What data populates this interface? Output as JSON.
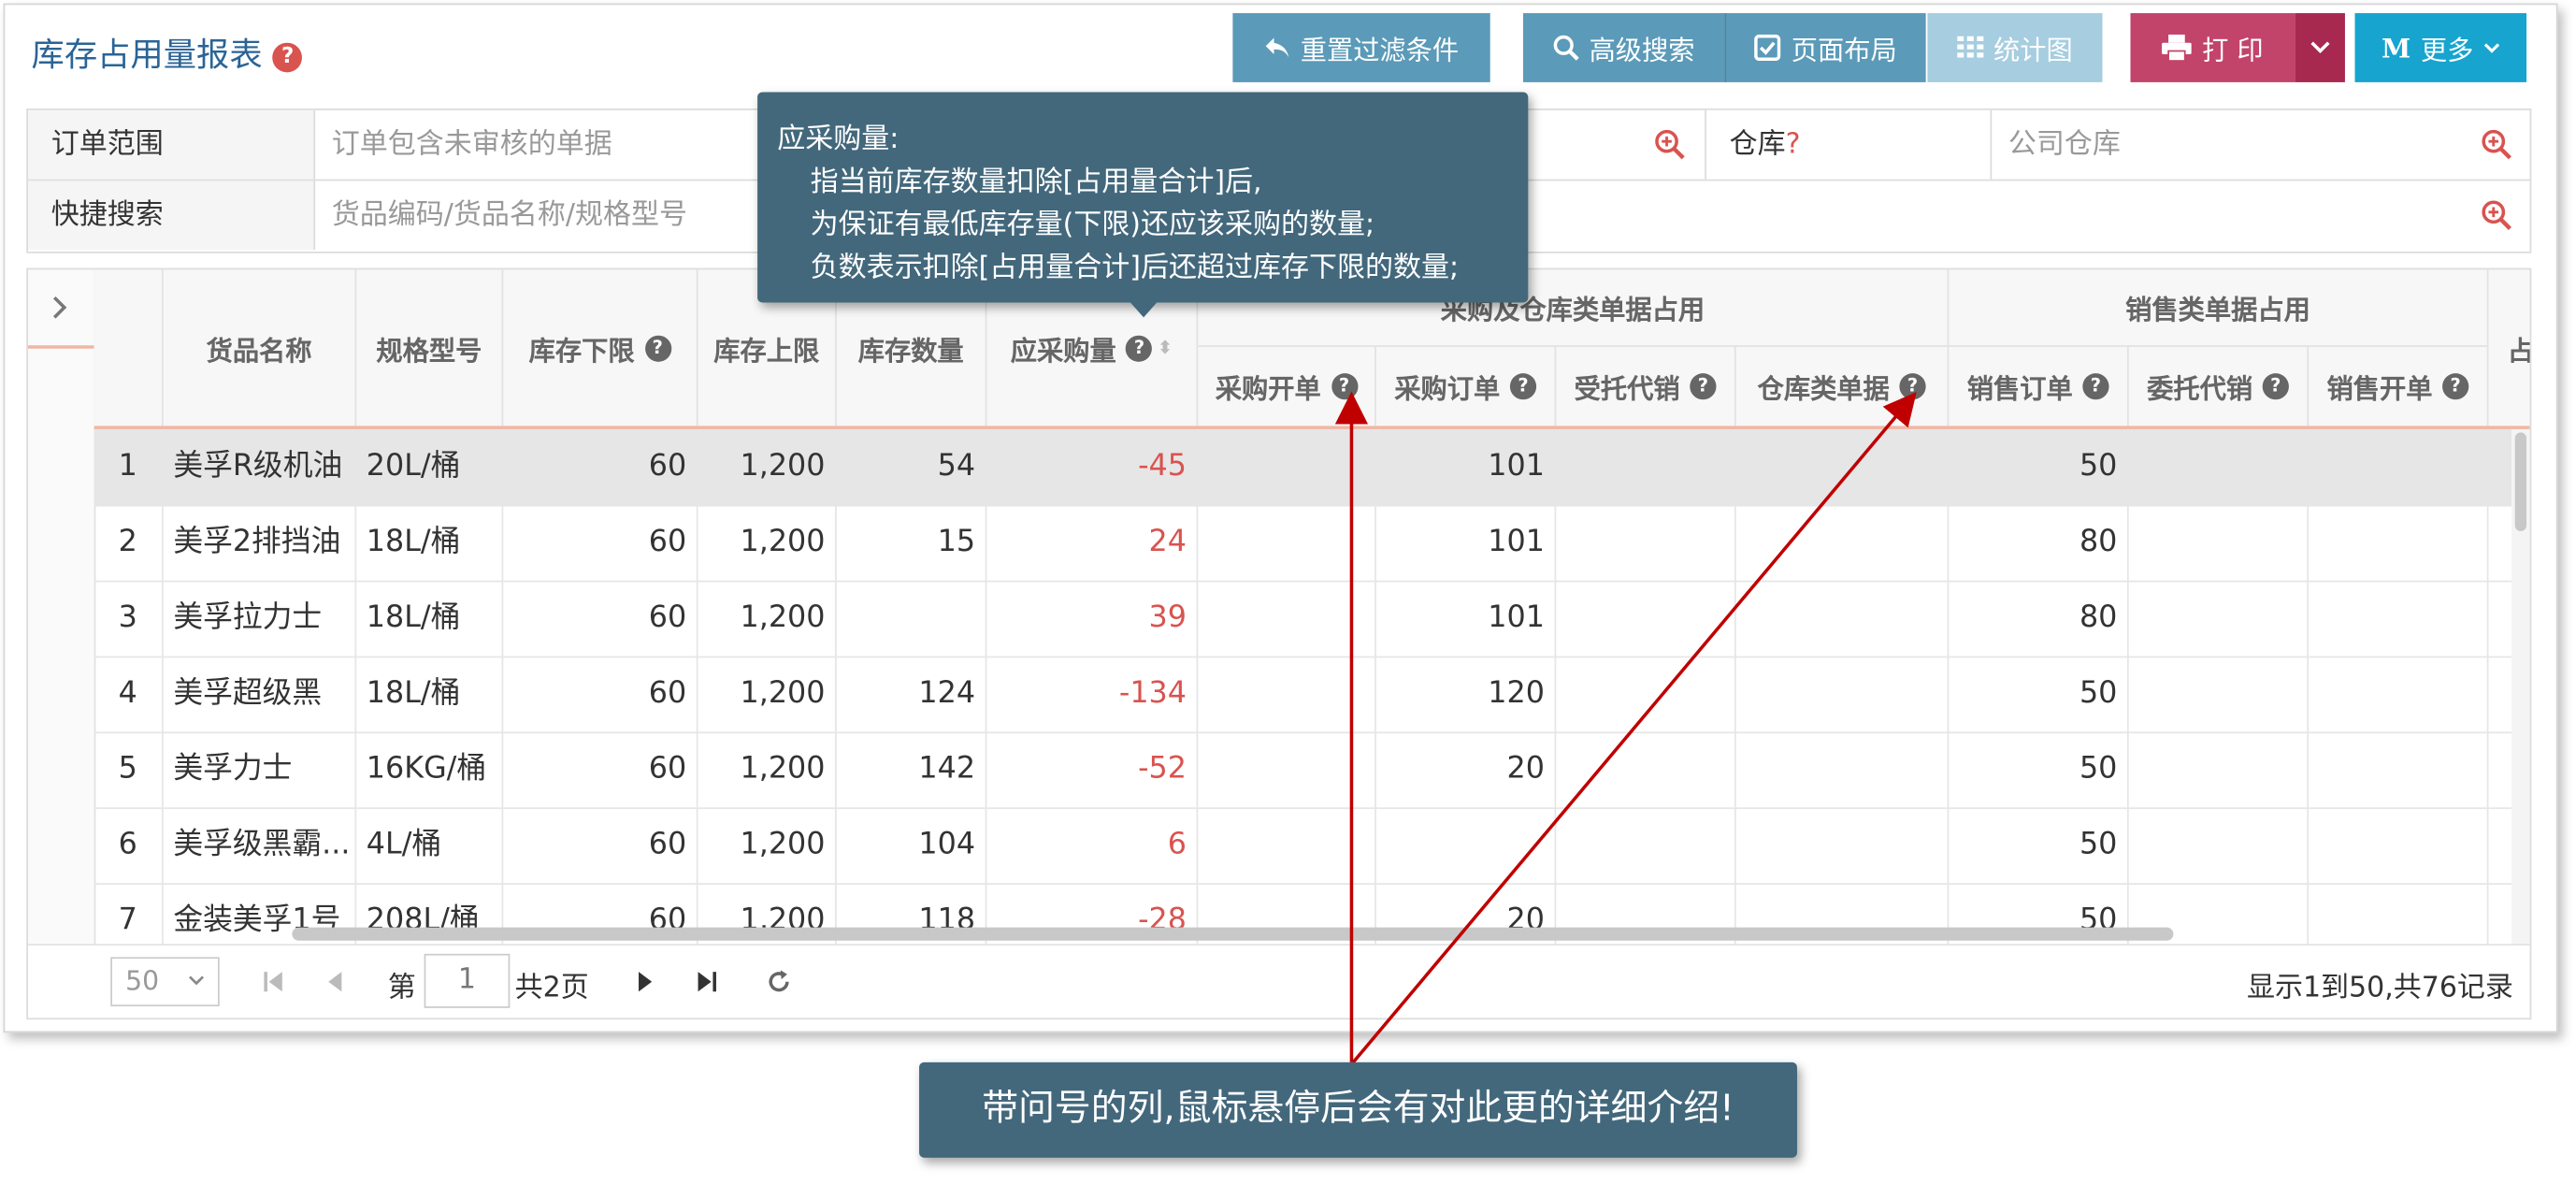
{
  "page": {
    "title": "库存占用量报表"
  },
  "toolbar": {
    "reset": "重置过滤条件",
    "advanced": "高级搜索",
    "layout": "页面布局",
    "chart": "统计图",
    "print": "打 印",
    "more": "更多",
    "more_glyph": "M"
  },
  "filters": {
    "order_scope_label": "订单范围",
    "order_scope_value": "订单包含未审核的单据",
    "warehouse_label": "仓库",
    "warehouse_hint": "?",
    "warehouse_value": "公司仓库",
    "quick_label": "快捷搜索",
    "quick_placeholder": "货品编码/货品名称/规格型号"
  },
  "grid": {
    "headers": {
      "name": "货品名称",
      "spec": "规格型号",
      "min": "库存下限",
      "max": "库存上限",
      "stock": "库存数量",
      "purchase_need": "应采购量",
      "group_purchase": "采购及仓库类单据占用",
      "group_sales": "销售类单据占用",
      "p_open": "采购开单",
      "p_order": "采购订单",
      "consign_in": "受托代销",
      "wh_docs": "仓库类单据",
      "s_order": "销售订单",
      "consign_out": "委托代销",
      "s_open": "销售开单",
      "overflow": "占"
    },
    "rows": [
      {
        "n": "1",
        "name": "美孚R级机油",
        "spec": "20L/桶",
        "min": "60",
        "max": "1,200",
        "stock": "54",
        "need": "-45",
        "p_order": "101",
        "s_order": "50"
      },
      {
        "n": "2",
        "name": "美孚2排挡油",
        "spec": "18L/桶",
        "min": "60",
        "max": "1,200",
        "stock": "15",
        "need": "24",
        "p_order": "101",
        "s_order": "80"
      },
      {
        "n": "3",
        "name": "美孚拉力士",
        "spec": "18L/桶",
        "min": "60",
        "max": "1,200",
        "stock": "",
        "need": "39",
        "p_order": "101",
        "s_order": "80"
      },
      {
        "n": "4",
        "name": "美孚超级黑",
        "spec": "18L/桶",
        "min": "60",
        "max": "1,200",
        "stock": "124",
        "need": "-134",
        "p_order": "120",
        "s_order": "50"
      },
      {
        "n": "5",
        "name": "美孚力士",
        "spec": "16KG/桶",
        "min": "60",
        "max": "1,200",
        "stock": "142",
        "need": "-52",
        "p_order": "20",
        "s_order": "50"
      },
      {
        "n": "6",
        "name": "美孚级黑霸...",
        "spec": "4L/桶",
        "min": "60",
        "max": "1,200",
        "stock": "104",
        "need": "6",
        "p_order": "",
        "s_order": "50"
      },
      {
        "n": "7",
        "name": "金装美孚1号",
        "spec": "208L/桶",
        "min": "60",
        "max": "1,200",
        "stock": "118",
        "need": "-28",
        "p_order": "20",
        "s_order": "50"
      }
    ]
  },
  "pager": {
    "page_size": "50",
    "page_prefix": "第",
    "page_value": "1",
    "page_total": "共2页",
    "summary": "显示1到50,共76记录"
  },
  "tooltip": {
    "title": "应采购量:",
    "line1": "指当前库存数量扣除[占用量合计]后,",
    "line2": "为保证有最低库存量(下限)还应该采购的数量;",
    "line3": "负数表示扣除[占用量合计]后还超过库存下限的数量;"
  },
  "callout": {
    "text": "带问号的列,鼠标悬停后会有对此更的详细介绍!"
  },
  "colors": {
    "accent": "#43687c",
    "negative": "#d9534f",
    "print": "#c2446a",
    "more": "#17a4cf"
  }
}
